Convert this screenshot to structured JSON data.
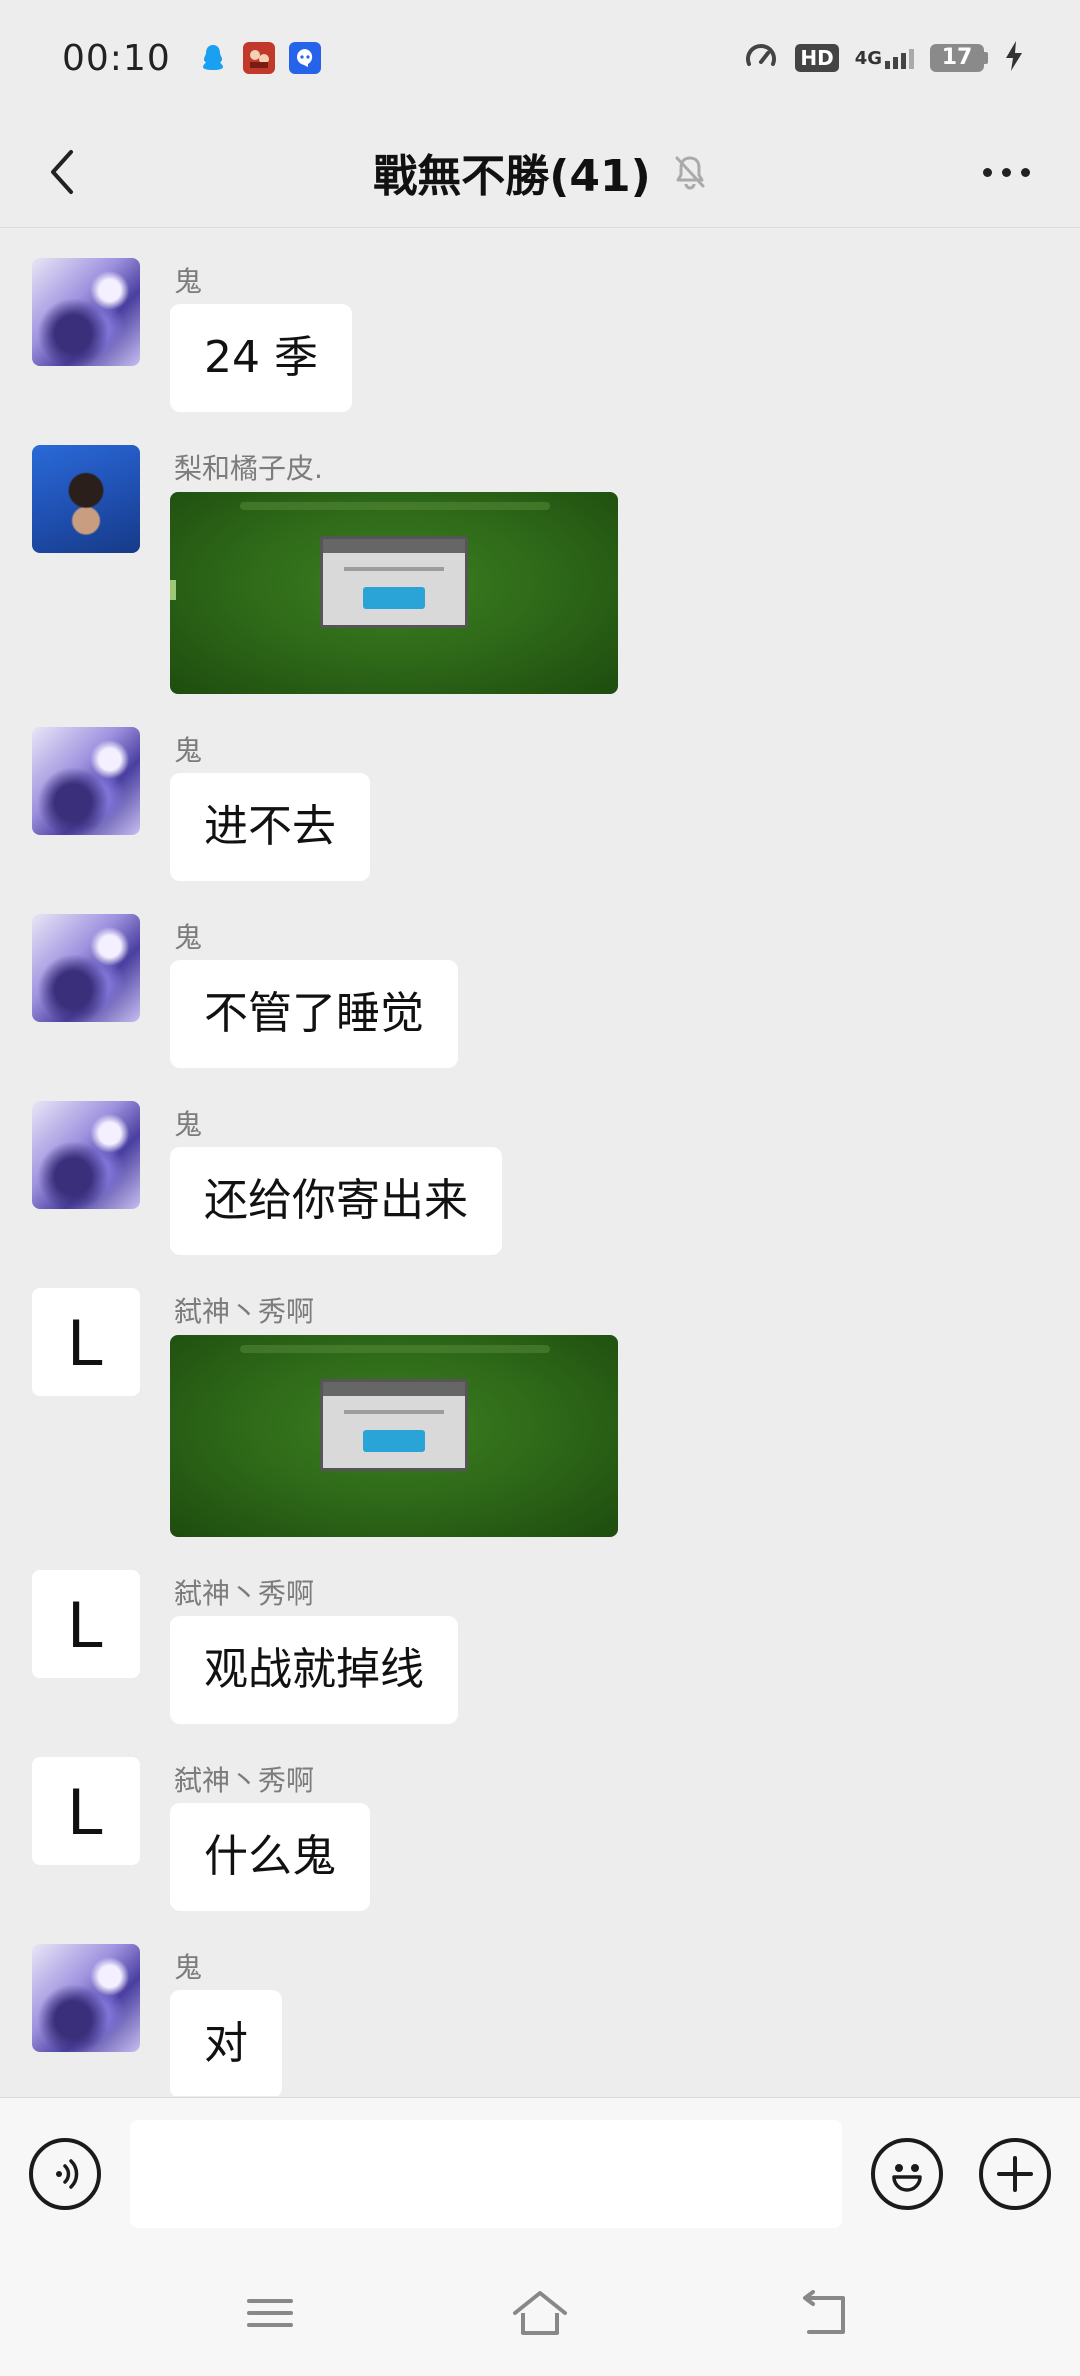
{
  "status_bar": {
    "time": "00:10",
    "hd_label": "HD",
    "network_label": "4G",
    "battery_level": "17"
  },
  "header": {
    "title": "戰無不勝(41)"
  },
  "messages": [
    {
      "sender": "鬼",
      "type": "text",
      "text": "24 季",
      "avatar": "gui"
    },
    {
      "sender": "梨和橘子皮.",
      "type": "image",
      "avatar": "li"
    },
    {
      "sender": "鬼",
      "type": "text",
      "text": "进不去",
      "avatar": "gui"
    },
    {
      "sender": "鬼",
      "type": "text",
      "text": "不管了睡觉",
      "avatar": "gui"
    },
    {
      "sender": "鬼",
      "type": "text",
      "text": "还给你寄出来",
      "avatar": "gui"
    },
    {
      "sender": "弑神丶秀啊",
      "type": "image",
      "avatar": "L"
    },
    {
      "sender": "弑神丶秀啊",
      "type": "text",
      "text": "观战就掉线",
      "avatar": "L"
    },
    {
      "sender": "弑神丶秀啊",
      "type": "text",
      "text": "什么鬼",
      "avatar": "L"
    },
    {
      "sender": "鬼",
      "type": "text",
      "text": "对",
      "avatar": "gui"
    }
  ],
  "avatar_letter": "L",
  "input": {
    "value": "",
    "placeholder": ""
  },
  "icons": {
    "back": "chevron-left-icon",
    "mute": "bell-off-icon",
    "more": "more-dots-icon",
    "voice": "voice-icon",
    "emoji": "emoji-icon",
    "plus": "plus-icon",
    "menu": "menu-icon",
    "home": "home-icon",
    "return": "return-icon"
  },
  "colors": {
    "background": "#ededed",
    "bubble": "#ffffff",
    "sender_name": "#7c7c7c"
  }
}
